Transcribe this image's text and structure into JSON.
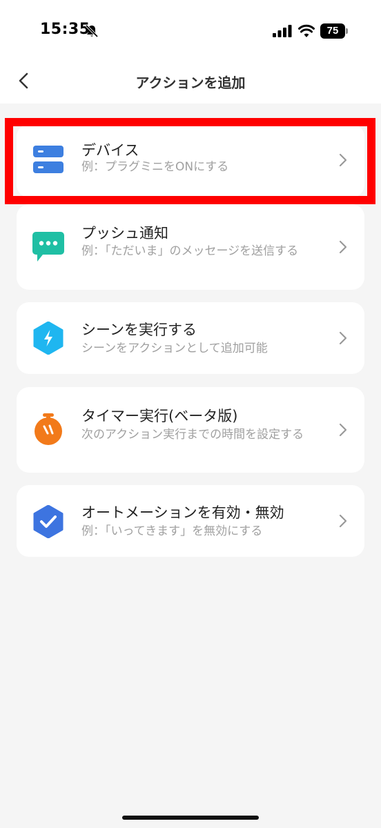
{
  "status_bar": {
    "time": "15:35",
    "battery": "75",
    "icons": [
      "bell-slash-icon",
      "signal-icon",
      "wifi-icon",
      "battery-icon"
    ]
  },
  "nav": {
    "title": "アクションを追加",
    "back_icon": "chevron-left-icon"
  },
  "actions": [
    {
      "title": "デバイス",
      "subtitle": "例：プラグミニをONにする",
      "icon": "device-list-icon",
      "color": "#3d7fe0"
    },
    {
      "title": "プッシュ通知",
      "subtitle": "例：「ただいま」のメッセージを送信する",
      "icon": "message-bubble-icon",
      "color": "#1fbfa4"
    },
    {
      "title": "シーンを実行する",
      "subtitle": "シーンをアクションとして追加可能",
      "icon": "lightning-hexagon-icon",
      "color": "#1fb6f0"
    },
    {
      "title": "タイマー実行(ベータ版)",
      "subtitle": "次のアクション実行までの時間を設定する",
      "icon": "stopwatch-icon",
      "color": "#f27a1a"
    },
    {
      "title": "オートメーションを有効・無効",
      "subtitle": "例：「いってきます」を無効にする",
      "icon": "check-shield-icon",
      "color": "#3d74e0"
    }
  ],
  "colors": {
    "highlight": "#ff0000",
    "background": "#f5f5f5",
    "card": "#ffffff"
  }
}
